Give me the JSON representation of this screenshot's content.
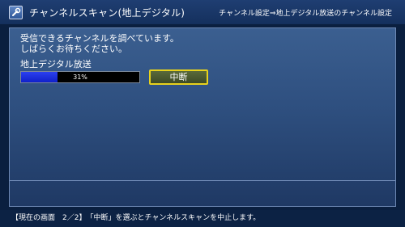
{
  "header": {
    "icon": "settings-tool-icon",
    "title": "チャンネルスキャン(地上デジタル)",
    "breadcrumb": "チャンネル設定⇒地上デジタル放送のチャンネル設定"
  },
  "main": {
    "message_line1": "受信できるチャンネルを調べています。",
    "message_line2": "しばらくお待ちください。",
    "section_label": "地上デジタル放送",
    "progress": {
      "value_percent": 31,
      "text": "31%"
    },
    "abort_button_label": "中断"
  },
  "footer": {
    "text": "【現在の画面　2／2】　「中断」を選ぶとチャンネルスキャンを中止します。"
  },
  "colors": {
    "background": "#0a1f3f",
    "panel": "#2e4f7f",
    "progress_fill": "#1f30e0",
    "button_highlight": "#e8d21c"
  }
}
